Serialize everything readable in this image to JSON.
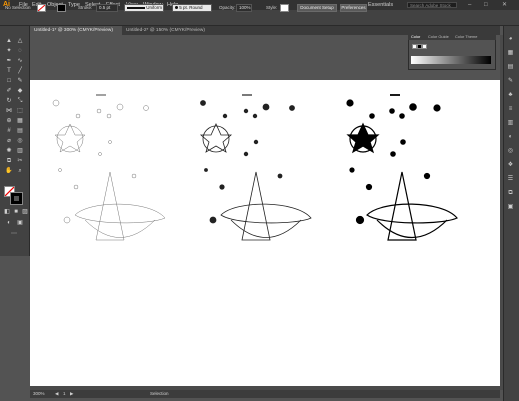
{
  "app": {
    "logo": "Ai"
  },
  "menu": [
    "File",
    "Edit",
    "Object",
    "Type",
    "Select",
    "Effect",
    "View",
    "Window",
    "Help"
  ],
  "workspace": "Essentials",
  "search_placeholder": "Search Adobe Stock",
  "window_buttons": [
    "–",
    "□",
    "✕"
  ],
  "control_bar": {
    "selection_label": "No Selection",
    "stroke_label": "Stroke:",
    "stroke_value": "0.5 pt",
    "profile_label": "Uniform",
    "brush_label": "5 pt. Round",
    "opacity_label": "Opacity:",
    "opacity_value": "100%",
    "style_label": "Style:",
    "document_setup": "Document Setup",
    "preferences": "Preferences"
  },
  "tabs": [
    {
      "label": "Untitled-1* @ 300% (CMYK/Preview)",
      "active": true
    },
    {
      "label": "Untitled-2* @ 150% (CMYK/Preview)",
      "active": false
    }
  ],
  "color_panel": {
    "tabs": [
      "Color",
      "Color Guide",
      "Color Theme"
    ]
  },
  "status": {
    "zoom": "300%",
    "page": "1",
    "tool": "Selection"
  },
  "colors": {
    "accent": "#ff9a00",
    "ui_dark": "#323232",
    "ui_mid": "#424242",
    "canvas": "#535353"
  }
}
